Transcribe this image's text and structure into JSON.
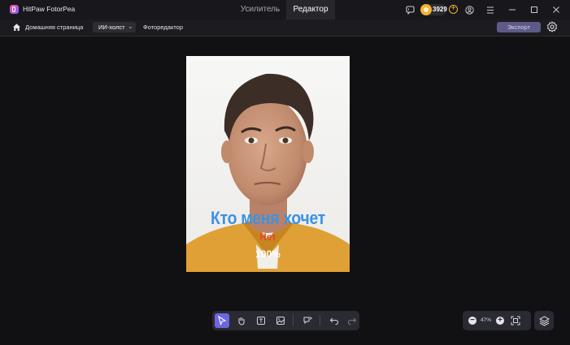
{
  "app": {
    "name": "HitPaw FotorPea",
    "logo": "fotorpea-logo"
  },
  "tabs": [
    {
      "label": "Усилитель",
      "active": false
    },
    {
      "label": "Редактор",
      "active": true
    }
  ],
  "titlebar": {
    "icons": [
      "feedback-icon",
      "coin-icon",
      "add-credits-icon",
      "account-icon",
      "menu-icon",
      "minimize-icon",
      "maximize-icon",
      "close-icon"
    ],
    "credits": "3929"
  },
  "subbar": {
    "home_label": "Домашняя страница",
    "ai_dropdown": "ИИ-холст",
    "breadcrumb": "Фоторедактор",
    "export_label": "Экспорт"
  },
  "canvas": {
    "overlay": [
      {
        "text": "Кто меня хочет",
        "color": "#3c92e4"
      },
      {
        "text": "Нет",
        "color": "#e8442a"
      },
      {
        "text": "100%",
        "color": "#ffffff"
      }
    ]
  },
  "toolbar": {
    "tools": [
      "select-tool-icon",
      "hand-tool-icon",
      "text-tool-icon",
      "image-tool-icon",
      "ai-chat-icon",
      "undo-icon",
      "redo-icon"
    ],
    "active_tool": "select-tool-icon"
  },
  "zoom": {
    "value": "47%"
  },
  "colors": {
    "accent": "#6e66e0",
    "export_bg": "#5d5a86",
    "coin": "#f2b233"
  }
}
